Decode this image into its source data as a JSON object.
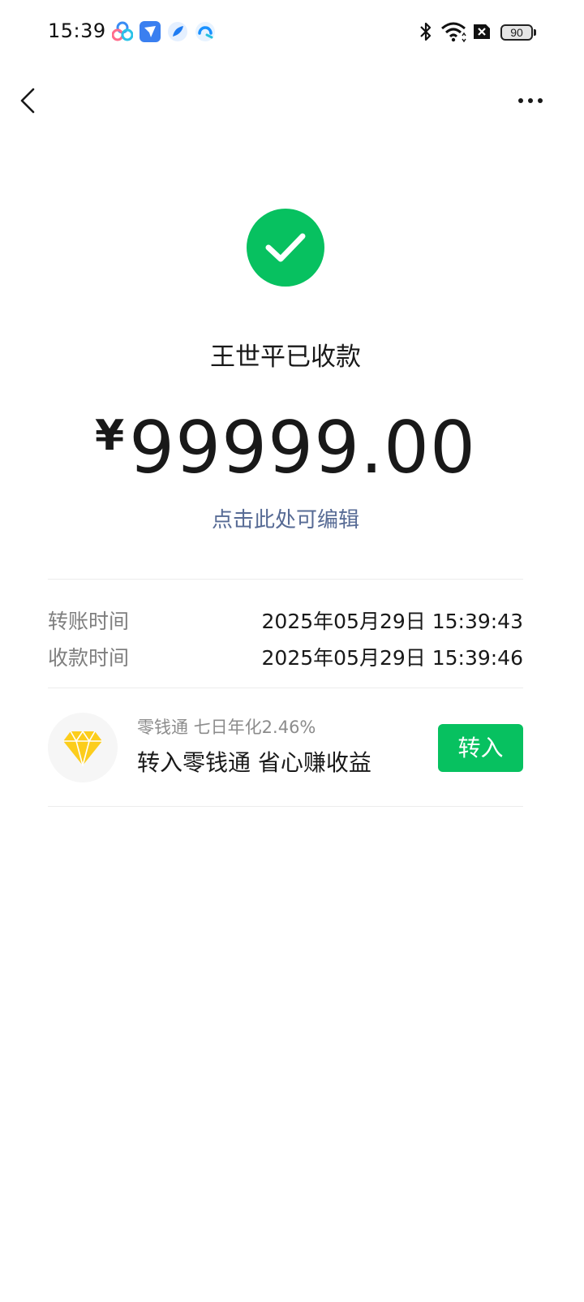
{
  "status_bar": {
    "time": "15:39",
    "battery_level": "90",
    "app_icons": [
      "baidu-netdisk-icon",
      "dingtalk-icon",
      "feather-app-icon",
      "qq-browser-icon"
    ],
    "system_icons": [
      "bluetooth-icon",
      "wifi-icon",
      "sim-disabled-icon",
      "battery-icon"
    ]
  },
  "nav": {
    "back_icon": "chevron-left-icon",
    "more_icon": "more-dots-icon"
  },
  "receipt": {
    "status_icon": "checkmark-circle-icon",
    "receiver_text": "王世平已收款",
    "currency": "¥",
    "amount": "99999.00",
    "edit_hint": "点击此处可编辑"
  },
  "details": [
    {
      "label": "转账时间",
      "value": "2025年05月29日 15:39:43"
    },
    {
      "label": "收款时间",
      "value": "2025年05月29日 15:39:46"
    }
  ],
  "promo": {
    "icon": "diamond-icon",
    "subtitle": "零钱通 七日年化2.46%",
    "title": "转入零钱通 省心赚收益",
    "button_label": "转入"
  },
  "colors": {
    "brand_green": "#07c160",
    "link_blue": "#576b95",
    "diamond_yellow": "#fccd1c"
  }
}
